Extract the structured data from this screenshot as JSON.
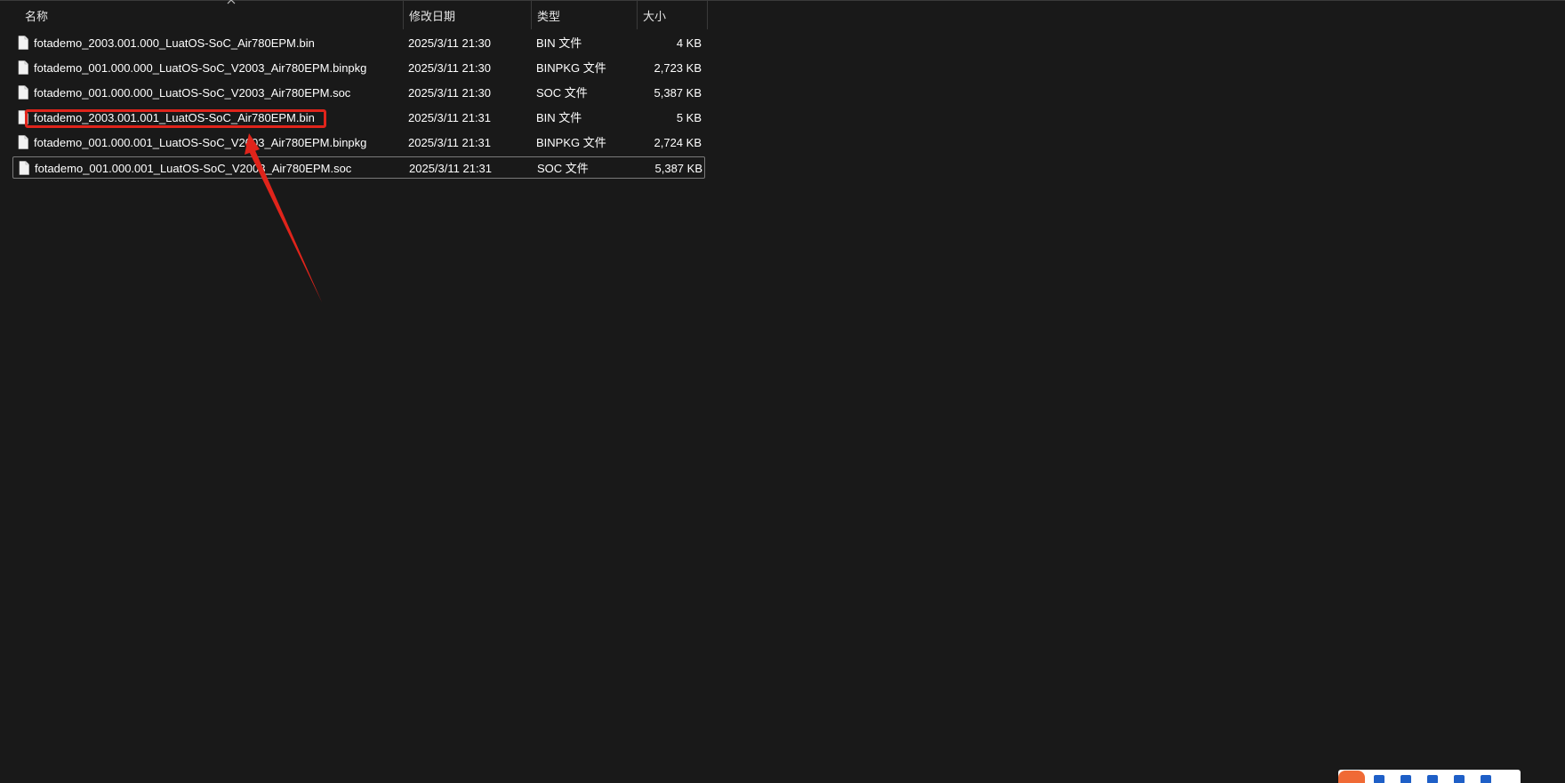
{
  "columns": {
    "name": "名称",
    "date": "修改日期",
    "type": "类型",
    "size": "大小"
  },
  "files": [
    {
      "name": "fotademo_2003.001.000_LuatOS-SoC_Air780EPM.bin",
      "date": "2025/3/11 21:30",
      "type": "BIN 文件",
      "size": "4 KB"
    },
    {
      "name": "fotademo_001.000.000_LuatOS-SoC_V2003_Air780EPM.binpkg",
      "date": "2025/3/11 21:30",
      "type": "BINPKG 文件",
      "size": "2,723 KB"
    },
    {
      "name": "fotademo_001.000.000_LuatOS-SoC_V2003_Air780EPM.soc",
      "date": "2025/3/11 21:30",
      "type": "SOC 文件",
      "size": "5,387 KB"
    },
    {
      "name": "fotademo_2003.001.001_LuatOS-SoC_Air780EPM.bin",
      "date": "2025/3/11 21:31",
      "type": "BIN 文件",
      "size": "5 KB"
    },
    {
      "name": "fotademo_001.000.001_LuatOS-SoC_V2003_Air780EPM.binpkg",
      "date": "2025/3/11 21:31",
      "type": "BINPKG 文件",
      "size": "2,724 KB"
    },
    {
      "name": "fotademo_001.000.001_LuatOS-SoC_V2003_Air780EPM.soc",
      "date": "2025/3/11 21:31",
      "type": "SOC 文件",
      "size": "5,387 KB"
    }
  ],
  "selected_index": 5,
  "highlighted_index": 3,
  "colors": {
    "background": "#191919",
    "annotation": "#e0241b",
    "selection_border": "#7a7a7a",
    "text": "#ffffff"
  },
  "icons": {
    "file": "file-icon",
    "sort": "sort-up-icon"
  }
}
